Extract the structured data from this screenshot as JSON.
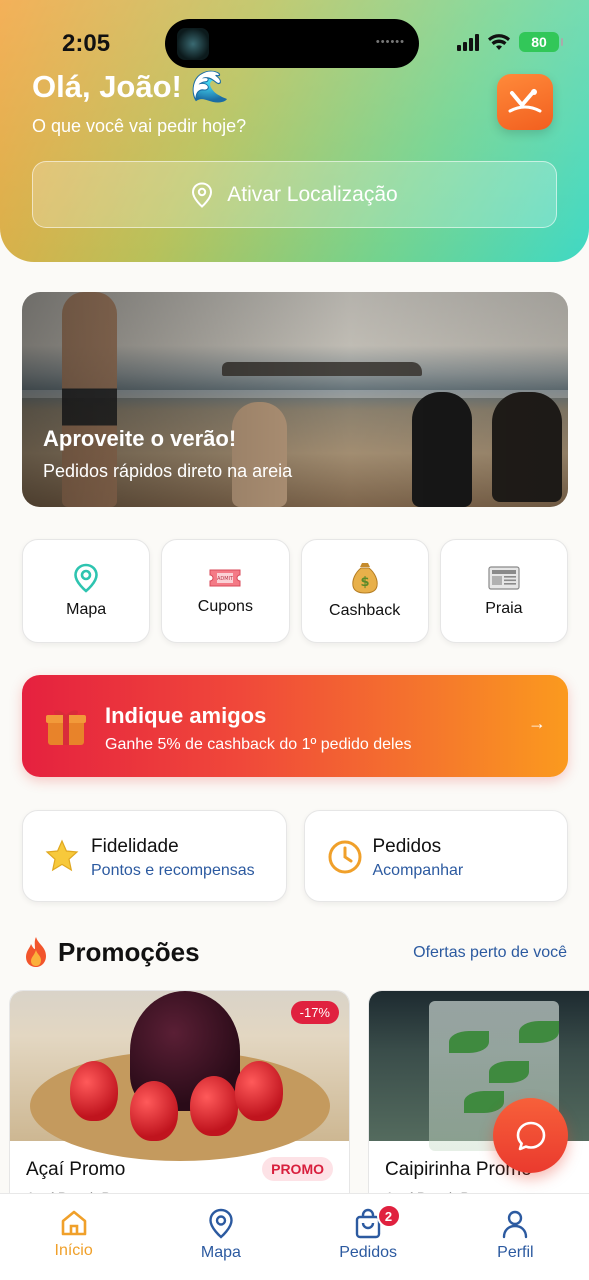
{
  "status_bar": {
    "time": "2:05",
    "battery": "80"
  },
  "header": {
    "greeting": "Olá, João! 🌊",
    "subtitle": "O que você vai pedir hoje?",
    "location_button": "Ativar Localização"
  },
  "hero": {
    "title": "Aproveite o verão!",
    "subtitle": "Pedidos rápidos direto na areia"
  },
  "quick_actions": [
    {
      "label": "Mapa",
      "icon": "map-pin-icon"
    },
    {
      "label": "Cupons",
      "icon": "ticket-icon"
    },
    {
      "label": "Cashback",
      "icon": "money-bag-icon"
    },
    {
      "label": "Praia",
      "icon": "newspaper-icon"
    }
  ],
  "referral": {
    "title": "Indique amigos",
    "subtitle": "Ganhe 5% de cashback do 1º pedido deles",
    "arrow": "→"
  },
  "cards": [
    {
      "title": "Fidelidade",
      "subtitle": "Pontos e recompensas",
      "icon": "star-icon"
    },
    {
      "title": "Pedidos",
      "subtitle": "Acompanhar",
      "icon": "clock-icon"
    }
  ],
  "promotions": {
    "title": "Promoções",
    "link": "Ofertas perto de você",
    "items": [
      {
        "name": "Açaí Promo",
        "badge": "PROMO",
        "discount": "-17%",
        "meta": "Açaí Beach Bar"
      },
      {
        "name": "Caipirinha Promo",
        "meta": "Açaí Beach Bar"
      }
    ]
  },
  "nav": [
    {
      "label": "Início",
      "icon": "home-icon",
      "active": true
    },
    {
      "label": "Mapa",
      "icon": "map-pin-icon"
    },
    {
      "label": "Pedidos",
      "icon": "bag-icon",
      "badge": "2"
    },
    {
      "label": "Perfil",
      "icon": "user-icon"
    }
  ],
  "colors": {
    "accent_orange": "#f0a02a",
    "nav_blue": "#2c5aa0",
    "promo_red": "#e0213f",
    "header_start": "#f2a33c",
    "header_end": "#3fd9c4"
  }
}
